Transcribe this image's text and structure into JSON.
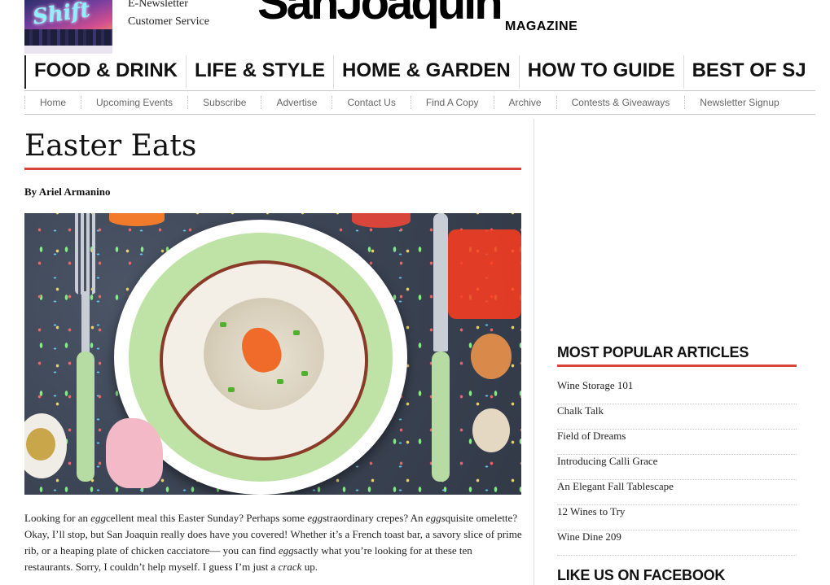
{
  "header": {
    "cover_text": "Shift",
    "top_links": [
      "E-Newsletter",
      "Customer Service"
    ],
    "logo_main": "SanJoaquin",
    "logo_sub": "MAGAZINE"
  },
  "main_nav": [
    "FOOD & DRINK",
    "LIFE & STYLE",
    "HOME & GARDEN",
    "HOW TO GUIDE",
    "BEST OF SJ"
  ],
  "sub_nav": [
    "Home",
    "Upcoming Events",
    "Subscribe",
    "Advertise",
    "Contact Us",
    "Find A Copy",
    "Archive",
    "Contests & Giveaways",
    "Newsletter Signup"
  ],
  "article": {
    "title": "Easter Eats",
    "byline": "By Ariel Armanino",
    "body_parts": [
      "Looking for an ",
      "egg",
      "cellent meal this Easter Sunday? Perhaps some ",
      "egg",
      "straordinary crepes? An ",
      "eggs",
      "quisite omelette? Okay, I’ll stop, but San Joaquin really does have you covered! Whether it’s a French toast bar, a savory slice of prime rib, or a heaping plate of chicken cacciatore— you can find ",
      "egg",
      "sactly what you’re looking for at these ten restaurants. Sorry, I couldn’t help myself. I guess I’m just a ",
      "crack",
      " up."
    ]
  },
  "sidebar": {
    "popular_heading": "MOST POPULAR ARTICLES",
    "popular": [
      "Wine Storage 101",
      "Chalk Talk",
      "Field of Dreams",
      "Introducing Calli Grace",
      "An Elegant Fall Tablescape",
      "12 Wines to Try",
      "Wine Dine 209"
    ],
    "facebook_heading": "LIKE US ON FACEBOOK"
  },
  "colors": {
    "accent": "#d7453b"
  }
}
